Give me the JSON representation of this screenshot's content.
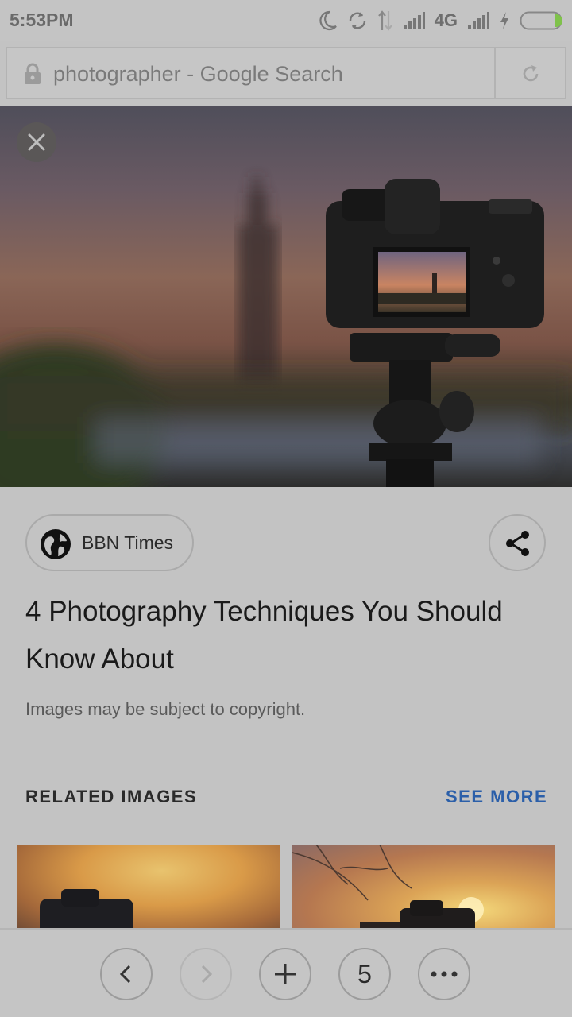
{
  "status_bar": {
    "time": "5:53PM",
    "network": "4G"
  },
  "address_bar": {
    "url_text": "photographer - Google Search"
  },
  "image_viewer": {
    "source": {
      "name": "BBN Times"
    },
    "title": "4 Photography Techniques You Should Know About",
    "copyright_notice": "Images may be subject to copyright.",
    "related": {
      "label": "RELATED IMAGES",
      "see_more": "SEE MORE"
    }
  },
  "bottom_toolbar": {
    "tab_count": "5"
  },
  "colors": {
    "link": "#2b5fa9",
    "battery_level": "#7fc24a"
  },
  "icons": [
    "moon-icon",
    "sync-icon",
    "data-arrows-icon",
    "signal-icon",
    "charging-icon",
    "battery-icon",
    "lock-icon",
    "reload-icon",
    "close-icon",
    "globe-icon",
    "share-icon",
    "back-icon",
    "forward-icon",
    "new-tab-icon",
    "more-icon"
  ]
}
